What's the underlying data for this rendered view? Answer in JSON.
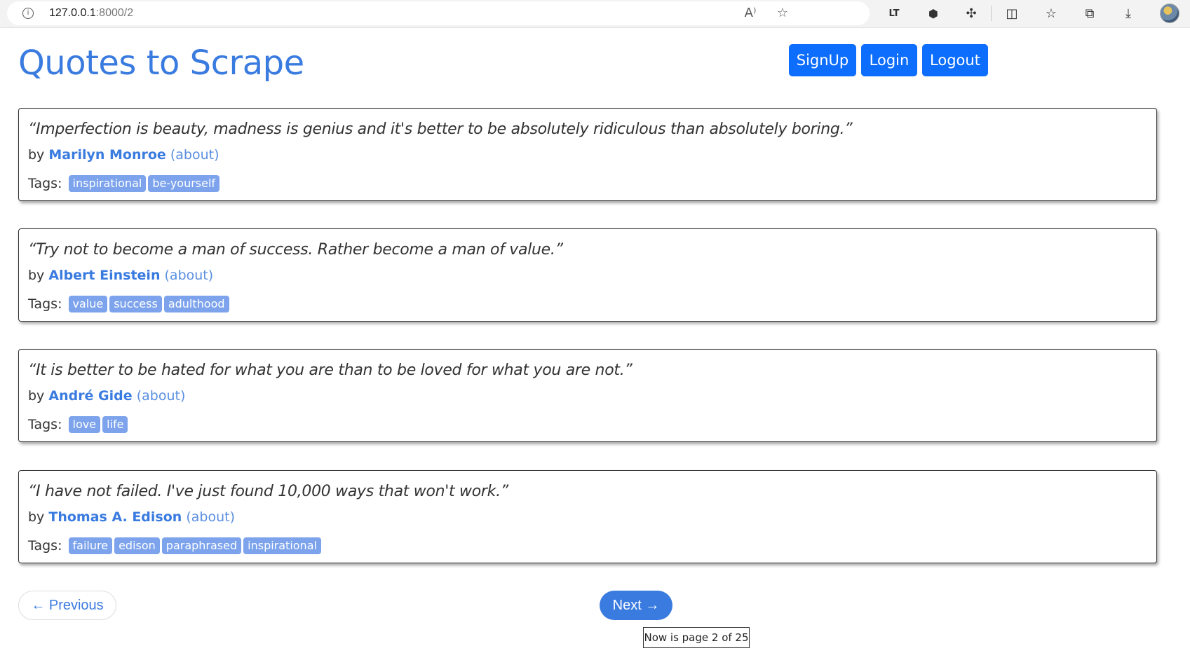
{
  "browser": {
    "url_host": "127.0.0.1",
    "url_rest": ":8000/2",
    "icons": [
      "info-icon",
      "read-aloud-icon",
      "favorite-star-icon",
      "languagetool-icon",
      "extension-shield-icon",
      "extensions-icon",
      "split-screen-icon",
      "favorites-icon",
      "collections-icon",
      "downloads-icon",
      "profile-avatar"
    ]
  },
  "header": {
    "title": "Quotes to Scrape",
    "signup_label": "SignUp",
    "login_label": "Login",
    "logout_label": "Logout"
  },
  "quotes": [
    {
      "text": "“Imperfection is beauty, madness is genius and it's better to be absolutely ridiculous than absolutely boring.”",
      "by": "by",
      "author": "Marilyn Monroe",
      "about": "(about)",
      "tags_label": "Tags:",
      "tags": [
        "inspirational",
        "be-yourself"
      ]
    },
    {
      "text": "“Try not to become a man of success. Rather become a man of value.”",
      "by": "by",
      "author": "Albert Einstein",
      "about": "(about)",
      "tags_label": "Tags:",
      "tags": [
        "value",
        "success",
        "adulthood"
      ]
    },
    {
      "text": "“It is better to be hated for what you are than to be loved for what you are not.”",
      "by": "by",
      "author": "André Gide",
      "about": "(about)",
      "tags_label": "Tags:",
      "tags": [
        "love",
        "life"
      ]
    },
    {
      "text": "“I have not failed. I've just found 10,000 ways that won't work.”",
      "by": "by",
      "author": "Thomas A. Edison",
      "about": "(about)",
      "tags_label": "Tags:",
      "tags": [
        "failure",
        "edison",
        "paraphrased",
        "inspirational"
      ]
    }
  ],
  "pager": {
    "previous_label": "← Previous",
    "next_label": "Next →",
    "tooltip": "Now is page 2 of 25"
  },
  "colors": {
    "accent": "#3a7be0",
    "button": "#0d6efd",
    "tag": "#7ca3ec"
  }
}
